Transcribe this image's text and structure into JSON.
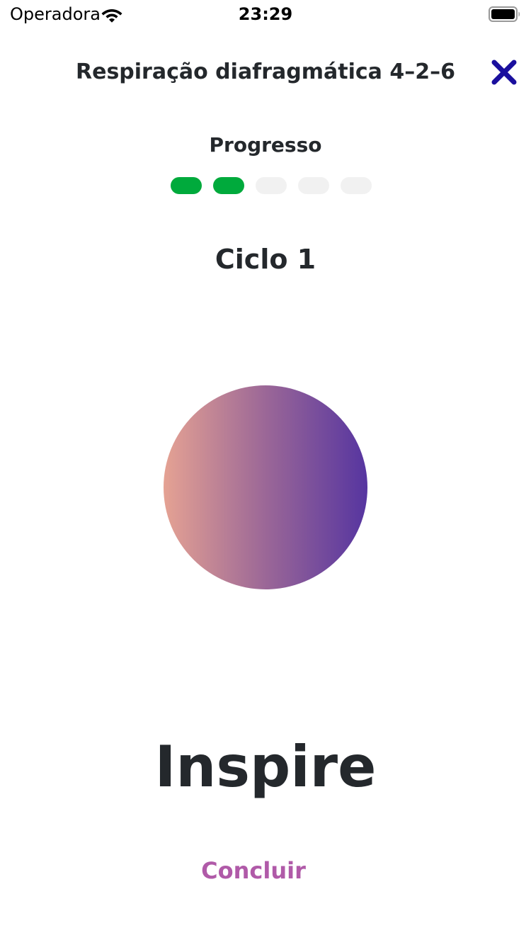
{
  "status_bar": {
    "carrier": "Operadora",
    "time": "23:29",
    "wifi_icon": "wifi-icon",
    "battery_icon": "battery-full-icon"
  },
  "header": {
    "title": "Respiração diafragmática 4–2–6",
    "close_icon": "close-icon",
    "close_color": "#1a0f9e"
  },
  "progress": {
    "label": "Progresso",
    "completed": 2,
    "total": 5,
    "done_color": "#00aa3c",
    "pending_color": "#f1f1f1"
  },
  "cycle": {
    "label": "Ciclo 1"
  },
  "breathing": {
    "gradient_start": "#e5a293",
    "gradient_end": "#5635a0",
    "instruction": "Inspire"
  },
  "actions": {
    "finish_label": "Concluir",
    "finish_color": "#b05aa8"
  }
}
